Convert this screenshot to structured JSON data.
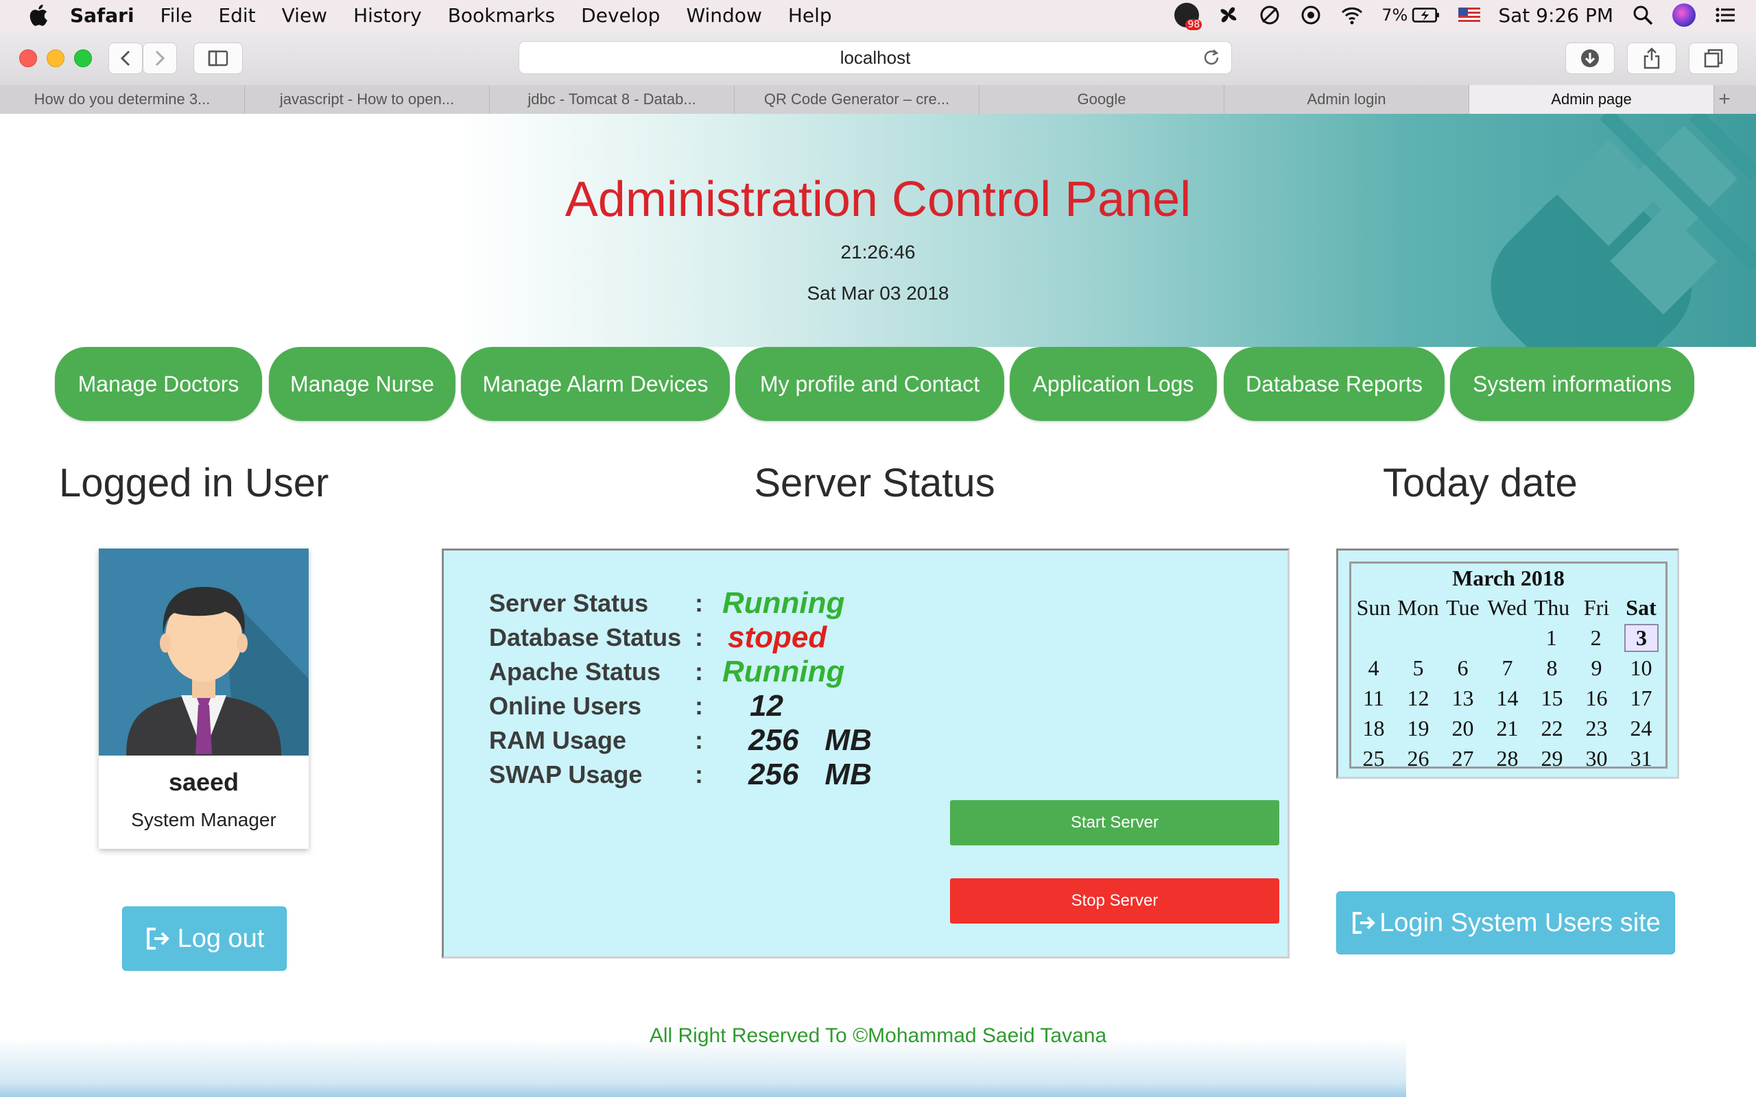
{
  "menubar": {
    "app_name": "Safari",
    "items": [
      "File",
      "Edit",
      "View",
      "History",
      "Bookmarks",
      "Develop",
      "Window",
      "Help"
    ],
    "badge_count": "98",
    "battery": "7%",
    "clock": "Sat 9:26 PM"
  },
  "browser": {
    "url": "localhost",
    "tabs": [
      {
        "label": "How do you determine 3..."
      },
      {
        "label": "javascript - How to open..."
      },
      {
        "label": "jdbc - Tomcat 8 - Datab..."
      },
      {
        "label": "QR Code Generator – cre..."
      },
      {
        "label": "Google"
      },
      {
        "label": "Admin login"
      },
      {
        "label": "Admin page"
      }
    ],
    "active_tab": 6
  },
  "header": {
    "title": "Administration Control Panel",
    "time": "21:26:46",
    "date": "Sat Mar 03 2018"
  },
  "nav": [
    {
      "label": "Manage Doctors"
    },
    {
      "label": "Manage Nurse"
    },
    {
      "label": "Manage Alarm Devices"
    },
    {
      "label": "My profile and Contact"
    },
    {
      "label": "Application Logs"
    },
    {
      "label": "Database Reports"
    },
    {
      "label": "System informations"
    }
  ],
  "user": {
    "heading": "Logged in User",
    "name": "saeed",
    "role": "System Manager",
    "logout_label": "Log out"
  },
  "server": {
    "heading": "Server Status",
    "rows": [
      {
        "label": "Server Status",
        "value": "Running",
        "unit": ""
      },
      {
        "label": "Database Status",
        "value": "stoped",
        "unit": ""
      },
      {
        "label": "Apache Status",
        "value": "Running",
        "unit": ""
      },
      {
        "label": "Online Users",
        "value": "12",
        "unit": ""
      },
      {
        "label": "RAM Usage",
        "value": "256",
        "unit": "MB"
      },
      {
        "label": "SWAP Usage",
        "value": "256",
        "unit": "MB"
      }
    ],
    "colon": ":",
    "start_label": "Start Server",
    "stop_label": "Stop Server"
  },
  "calendar": {
    "heading": "Today date",
    "month": "March 2018",
    "weekdays": [
      "Sun",
      "Mon",
      "Tue",
      "Wed",
      "Thu",
      "Fri",
      "Sat"
    ],
    "weeks": [
      [
        "",
        "",
        "",
        "",
        "1",
        "2",
        "3"
      ],
      [
        "4",
        "5",
        "6",
        "7",
        "8",
        "9",
        "10"
      ],
      [
        "11",
        "12",
        "13",
        "14",
        "15",
        "16",
        "17"
      ],
      [
        "18",
        "19",
        "20",
        "21",
        "22",
        "23",
        "24"
      ],
      [
        "25",
        "26",
        "27",
        "28",
        "29",
        "30",
        "31"
      ]
    ],
    "today": "3"
  },
  "login_site_label": "Login System Users site",
  "footer": "All Right Reserved To ©Mohammad Saeid Tavana",
  "colors": {
    "title_red": "#d9242b",
    "nav_green": "#4cae50",
    "running_green": "#34b233",
    "stopped_red": "#e0201b",
    "info_blue": "#5bc0de",
    "panel_bg": "#cbf3fa",
    "stop_btn_red": "#f0312c"
  }
}
